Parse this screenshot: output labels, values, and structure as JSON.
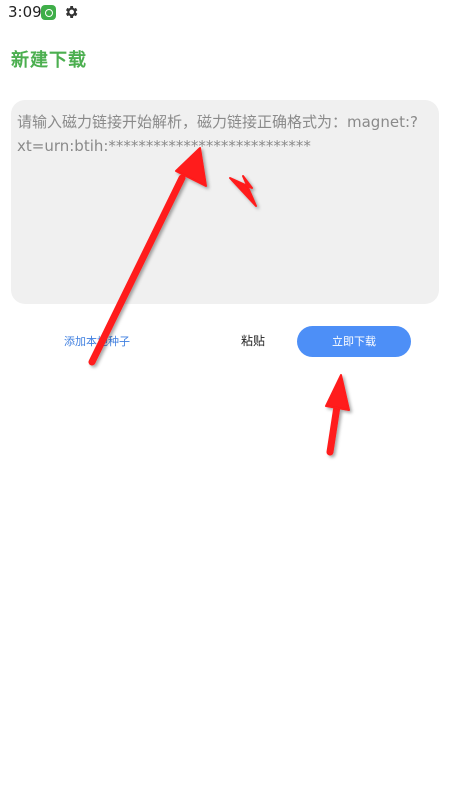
{
  "status_bar": {
    "time": "3:09",
    "icons": [
      "app-icon",
      "gear-icon"
    ]
  },
  "header": {
    "title": "新建下载"
  },
  "magnet_input": {
    "placeholder": "请输入磁力链接开始解析，磁力链接正确格式为：magnet:?xt=urn:btih:***************************",
    "value": ""
  },
  "actions": {
    "add_local_torrent": "添加本地种子",
    "paste": "粘贴",
    "download_now": "立即下载"
  },
  "colors": {
    "title": "#4caf50",
    "primary_button": "#4d8ff7",
    "link": "#3f7fe0",
    "input_bg": "#f0f0f0",
    "annotation_arrow": "#ff1a1a"
  }
}
